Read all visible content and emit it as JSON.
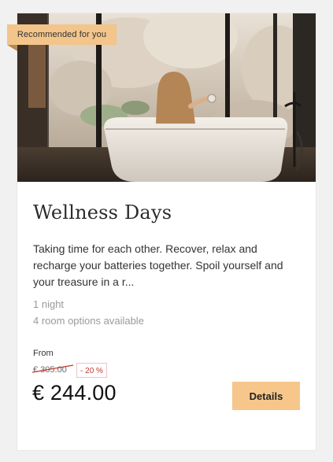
{
  "card": {
    "ribbon_label": "Recommended for you",
    "title": "Wellness Days",
    "description": "Taking time for each other. Recover, relax and recharge your batteries together. Spoil yourself and your treasure in a r...",
    "nights": "1 night",
    "room_options": "4 room options available",
    "price_prefix": "From",
    "old_price": "€ 305.00",
    "discount": "- 20 %",
    "price": "€ 244.00",
    "details_label": "Details"
  },
  "colors": {
    "page_background": "#f1f1f1",
    "card_background": "#ffffff",
    "accent": "#f6c68b",
    "discount_red": "#c0392b"
  },
  "image": {
    "subject": "woman-relaxing-in-bathtub-by-window"
  }
}
